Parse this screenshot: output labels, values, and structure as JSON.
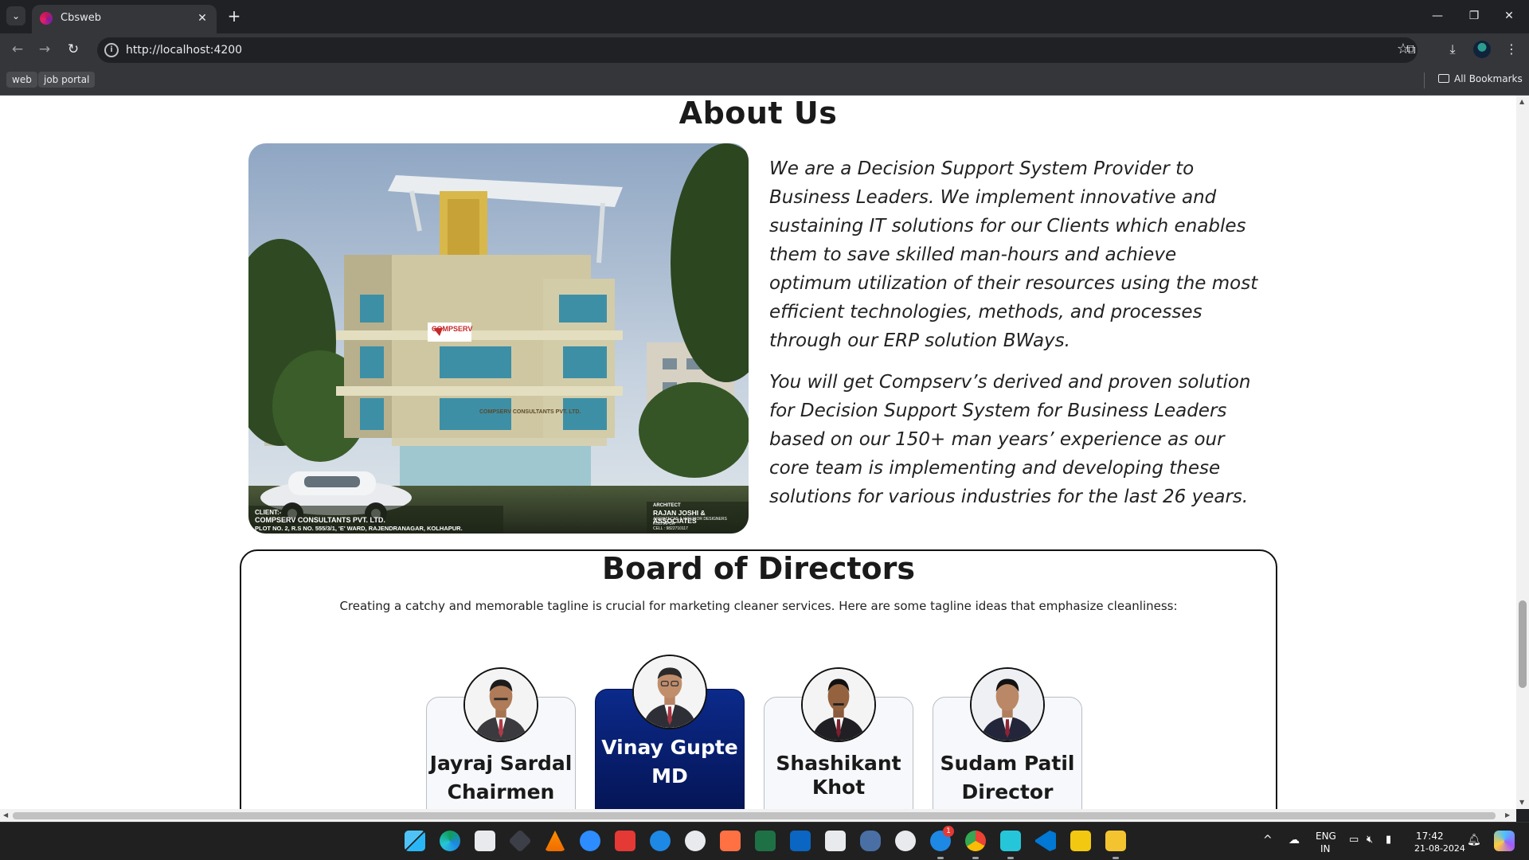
{
  "browser": {
    "tab_title": "Cbsweb",
    "url": "http://localhost:4200",
    "bookmarks": [
      "web",
      "job portal"
    ],
    "all_bookmarks_label": "All Bookmarks"
  },
  "about": {
    "title": "About Us",
    "paragraph1": "We are a Decision Support System Provider to Business Leaders. We implement innovative and sustaining IT solutions for our Clients which enables them to save skilled man-hours and achieve optimum utilization of their resources using the most efficient technologies, methods, and processes through our ERP solution BWays.",
    "paragraph2": "You will get Compserv’s derived and proven solution for Decision Support System for Business Leaders based on our 150+ man years’ experience as our core team is implementing and developing these solutions for various industries for the last 26 years.",
    "image": {
      "sign_text": "COMPSERV",
      "facade_text": "COMPSERV CONSULTANTS PVT. LTD.",
      "client_label": "CLIENT:-",
      "client_name": "COMPSERV CONSULTANTS PVT. LTD.",
      "client_address": "PLOT NO. 2, R.S NO. 555/3/1, 'E' WARD, RAJENDRANAGAR, KOLHAPUR.",
      "architect_label": "ARCHITECT",
      "architect_name": "RAJAN JOSHI & ASSOCIATES",
      "architect_sub": "ARCHITECTS & INTERIOR DESIGNERS",
      "architect_city": "KOLHAPUR",
      "architect_cell": "CELL : 9822710117"
    }
  },
  "board": {
    "title": "Board of Directors",
    "tagline": "Creating a catchy and memorable tagline is crucial for marketing cleaner services. Here are some tagline ideas that emphasize cleanliness:",
    "directors": [
      {
        "name": "Jayraj Sardal",
        "role": "Chairmen"
      },
      {
        "name": "Vinay Gupte",
        "role": "MD"
      },
      {
        "name": "Shashikant Khot",
        "role": ""
      },
      {
        "name": "Sudam Patil",
        "role": "Director"
      }
    ]
  },
  "taskbar": {
    "language": "ENG",
    "region": "IN",
    "time": "17:42",
    "date": "21-08-2024",
    "skype_badge": "1"
  }
}
